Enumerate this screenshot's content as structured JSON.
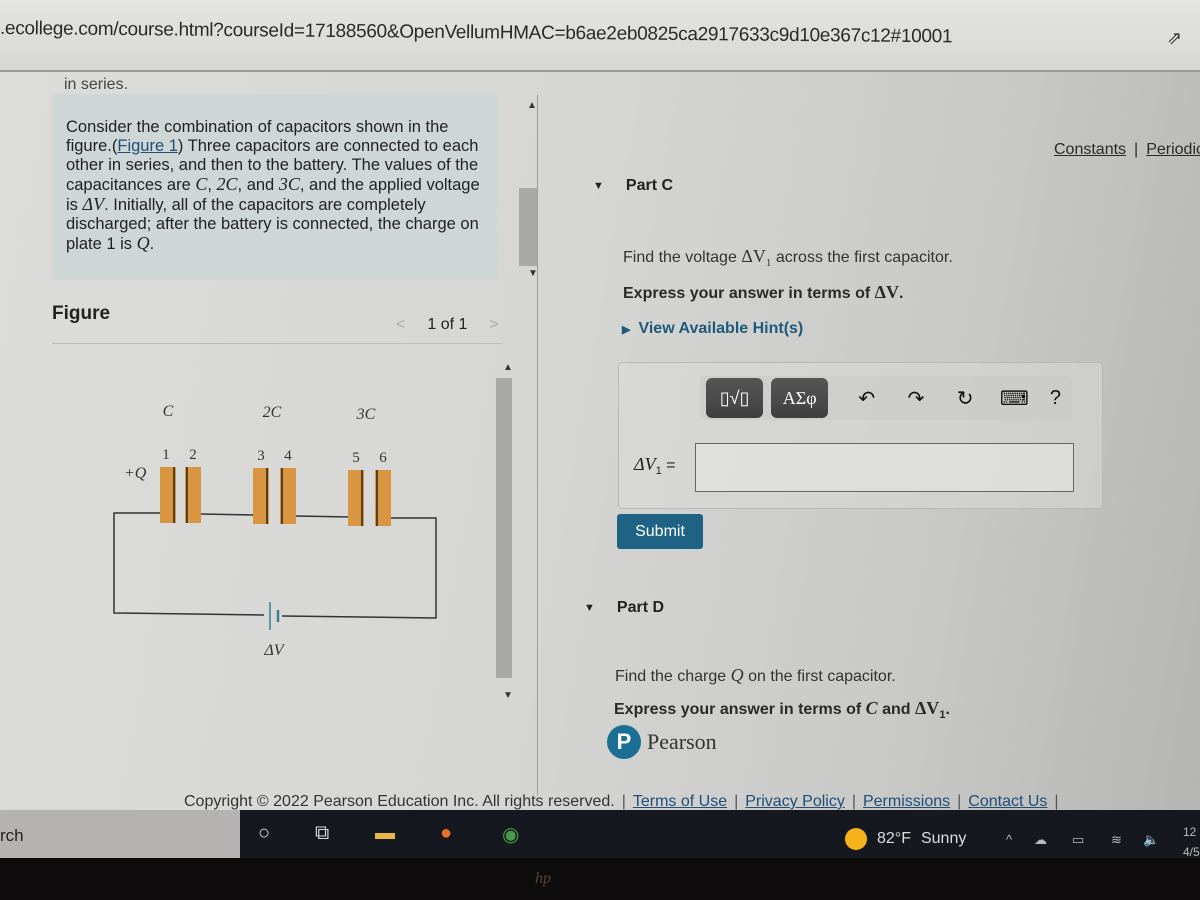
{
  "browser": {
    "url": ".ecollege.com/course.html?courseId=17188560&OpenVellumHMAC=b6ae2eb0825ca2917633c9d10e367c12#10001",
    "share_icon": "share-icon"
  },
  "problem": {
    "cut_text": "in series.",
    "intro_parts": {
      "p1": "Consider the combination of capacitors shown in the figure.(",
      "figure_link": "Figure 1",
      "p2": ") Three capacitors are connected to each other in series, and then to the battery. The values of the capacitances are ",
      "c1": "C",
      "sep1": ", ",
      "c2": "2C",
      "sep2": ", and ",
      "c3": "3C",
      "p3": ", and the applied voltage is ",
      "dv": "ΔV",
      "p4": ". Initially, all of the capacitors are completely discharged; after the battery is connected, the charge on plate 1 is ",
      "q": "Q",
      "p5": "."
    }
  },
  "figure": {
    "title": "Figure",
    "pager": "1 of 1",
    "prev_icon": "chevron-left-icon",
    "next_icon": "chevron-right-icon",
    "capacitor_labels": [
      "C",
      "2C",
      "3C"
    ],
    "plate_labels": [
      "1",
      "2",
      "3",
      "4",
      "5",
      "6"
    ],
    "charge_label": "+Q",
    "battery_label": "ΔV",
    "plate_color": "#d9953f"
  },
  "links": {
    "constants": "Constants",
    "separator": "|",
    "periodic": "Periodic Table"
  },
  "part_c": {
    "title": "Part C",
    "question_pre": "Find the voltage ",
    "question_var": "ΔV",
    "question_sub": "1",
    "question_post": " across the first capacitor.",
    "express_pre": "Express your answer in terms of ",
    "express_var": "ΔV",
    "express_post": ".",
    "hint": "View Available Hint(s)",
    "toolbar": {
      "template_label": "▯√▯",
      "greek_label": "ΑΣφ",
      "undo": "↶",
      "redo": "↷",
      "reset": "↻",
      "keyboard": "⌨",
      "help": "?"
    },
    "lhs": "ΔV",
    "lhs_sub": "1",
    "lhs_eq": " =",
    "answer_value": "",
    "submit": "Submit"
  },
  "part_d": {
    "title": "Part D",
    "question_pre": "Find the charge ",
    "question_var": "Q",
    "question_post": " on the first capacitor.",
    "express_pre": "Express your answer in terms of ",
    "express_var1": "C",
    "express_mid": " and ",
    "express_var2": "ΔV",
    "express_sub": "1",
    "express_post": "."
  },
  "brand": {
    "logo_letter": "P",
    "name": "Pearson",
    "color": "#1b6f95"
  },
  "footer": {
    "copyright": "Copyright © 2022 Pearson Education Inc. All rights reserved.",
    "sep": "|",
    "terms": "Terms of Use",
    "privacy": "Privacy Policy",
    "permissions": "Permissions",
    "contact": "Contact Us"
  },
  "taskbar": {
    "search_text": "rch",
    "weather_temp": "82°F",
    "weather_desc": "Sunny",
    "clock_time": "12",
    "clock_date": "4/5",
    "tray_up": "^"
  },
  "bezel": {
    "logo": "hp"
  }
}
